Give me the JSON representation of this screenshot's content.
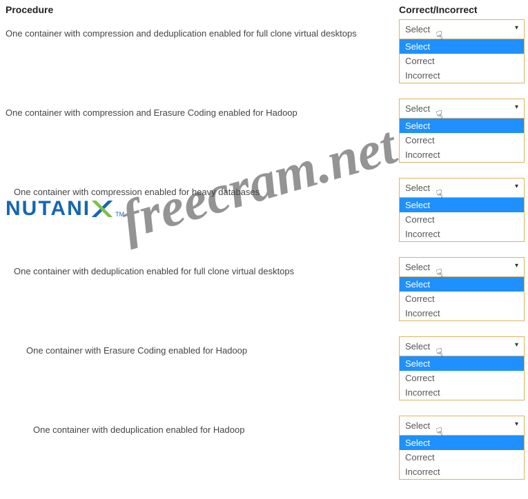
{
  "headers": {
    "procedure": "Procedure",
    "ci": "Correct/Incorrect"
  },
  "dropdown": {
    "placeholder": "Select",
    "options": [
      "Select",
      "Correct",
      "Incorrect"
    ]
  },
  "rows": [
    {
      "text": "One container with compression and deduplication enabled for full clone virtual desktops"
    },
    {
      "text": "One container with compression and Erasure Coding enabled for Hadoop"
    },
    {
      "text": "One container with compression enabled for heavy databases"
    },
    {
      "text": "One container with deduplication enabled for full clone virtual desktops"
    },
    {
      "text": "One container with Erasure Coding enabled for Hadoop"
    },
    {
      "text": "One container with deduplication enabled for Hadoop"
    }
  ],
  "logo": {
    "text": "NUTANI",
    "tm": "TM"
  },
  "watermark": "freecram.net",
  "cursor_glyph": "☟"
}
